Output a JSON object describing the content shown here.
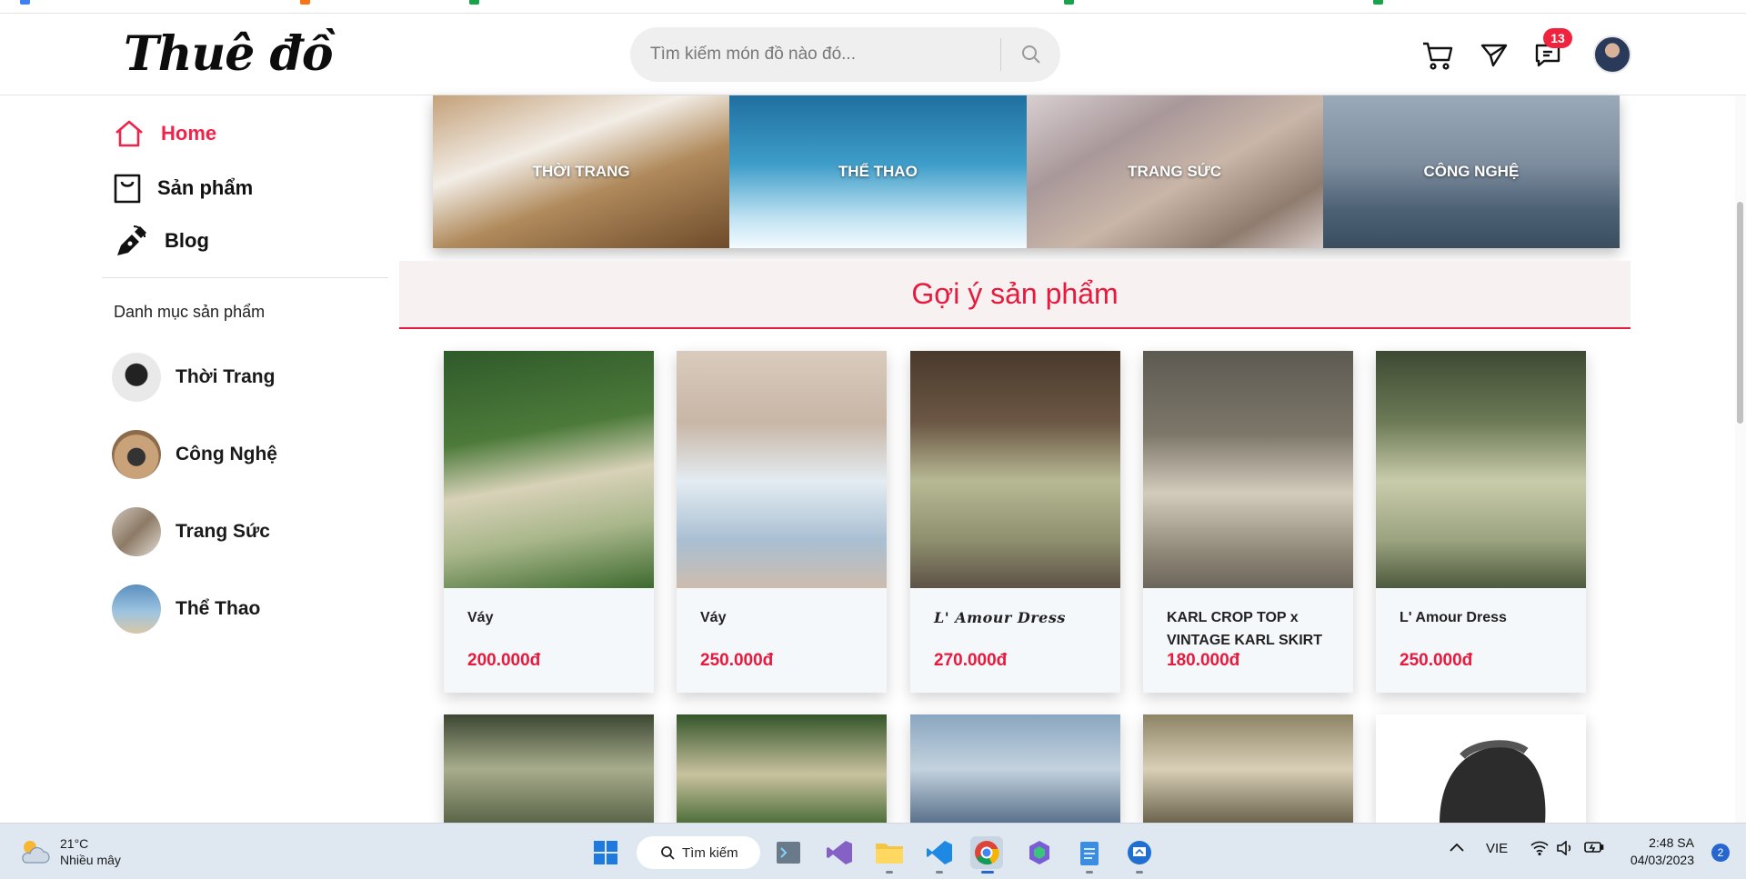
{
  "header": {
    "logo": "Thuê đồ",
    "search_placeholder": "Tìm kiếm món đồ nào đó...",
    "notification_count": "13"
  },
  "sidebar": {
    "nav": [
      {
        "label": "Home",
        "icon": "home-icon",
        "active": true
      },
      {
        "label": "Sản phẩm",
        "icon": "shopping-bag-icon",
        "active": false
      },
      {
        "label": "Blog",
        "icon": "pen-nib-icon",
        "active": false
      }
    ],
    "category_heading": "Danh mục sản phẩm",
    "categories": [
      {
        "label": "Thời Trang"
      },
      {
        "label": "Công Nghệ"
      },
      {
        "label": "Trang Sức"
      },
      {
        "label": "Thể Thao"
      }
    ]
  },
  "banner": {
    "tiles": [
      {
        "label": "THỜI TRANG"
      },
      {
        "label": "THỂ THAO"
      },
      {
        "label": "TRANG SỨC"
      },
      {
        "label": "CÔNG NGHỆ"
      }
    ]
  },
  "suggestions": {
    "title": "Gợi ý sản phẩm",
    "products": [
      {
        "name": "Váy",
        "price": "200.000đ"
      },
      {
        "name": "Váy",
        "price": "250.000đ"
      },
      {
        "name": "L' Amour Dress",
        "price": "270.000đ"
      },
      {
        "name": "KARL CROP TOP x VINTAGE KARL SKIRT",
        "price": "180.000đ"
      },
      {
        "name": "L' Amour Dress",
        "price": "250.000đ"
      }
    ]
  },
  "taskbar": {
    "weather_temp": "21°C",
    "weather_desc": "Nhiều mây",
    "search_label": "Tìm kiếm",
    "language": "VIE",
    "time": "2:48 SA",
    "date": "04/03/2023",
    "notification_count": "2"
  },
  "colors": {
    "accent": "#e8193c",
    "taskbar": "#dfe8f1"
  }
}
